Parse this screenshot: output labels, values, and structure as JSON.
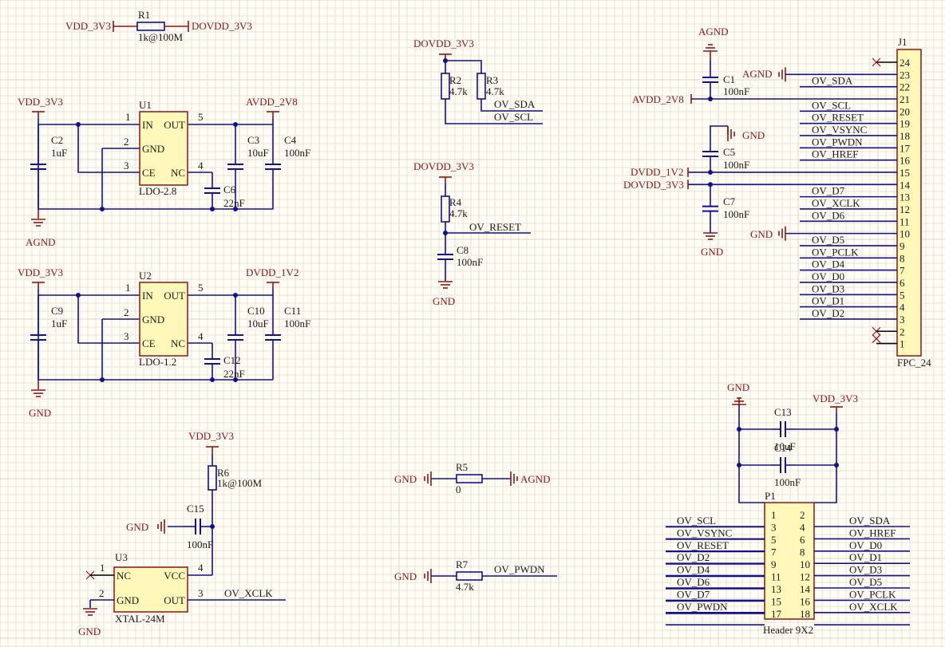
{
  "colors": {
    "wire": "#11118a",
    "power": "#8b1515",
    "pin": "#000000",
    "text": "#1a1a1a",
    "chip_fill": "#fff8b8",
    "chip_stroke": "#8b1515",
    "grid": "#e9e4d6",
    "grid_major": "#ddd6c4",
    "x_mark": "#a01010"
  },
  "r1": {
    "designator": "R1",
    "value": "1k@100M",
    "net_left": "VDD_3V3",
    "net_right": "DOVDD_3V3"
  },
  "u1": {
    "designator": "U1",
    "part": "LDO-2.8",
    "pin_in": "IN",
    "pin_out": "OUT",
    "pin_gnd": "GND",
    "pin_ce": "CE",
    "pin_nc": "NC",
    "num_1": "1",
    "num_2": "2",
    "num_3": "3",
    "num_4": "4",
    "num_5": "5",
    "net_in": "VDD_3V3",
    "net_out": "AVDD_2V8",
    "net_gnd": "AGND",
    "c_in": {
      "designator": "C2",
      "value": "1uF"
    },
    "c_out1": {
      "designator": "C3",
      "value": "10uF"
    },
    "c_out2": {
      "designator": "C4",
      "value": "100nF"
    },
    "c_nc": {
      "designator": "C6",
      "value": "22nF"
    }
  },
  "u2": {
    "designator": "U2",
    "part": "LDO-1.2",
    "pin_in": "IN",
    "pin_out": "OUT",
    "pin_gnd": "GND",
    "pin_ce": "CE",
    "pin_nc": "NC",
    "num_1": "1",
    "num_2": "2",
    "num_3": "3",
    "num_4": "4",
    "num_5": "5",
    "net_in": "VDD_3V3",
    "net_out": "DVDD_1V2",
    "net_gnd": "GND",
    "c_in": {
      "designator": "C9",
      "value": "1uF"
    },
    "c_out1": {
      "designator": "C10",
      "value": "10uF"
    },
    "c_out2": {
      "designator": "C11",
      "value": "100nF"
    },
    "c_nc": {
      "designator": "C12",
      "value": "22nF"
    }
  },
  "u3": {
    "designator": "U3",
    "part": "XTAL-24M",
    "pin_nc": "NC",
    "pin_vcc": "VCC",
    "pin_gnd": "GND",
    "pin_out": "OUT",
    "num_1": "1",
    "num_2": "2",
    "num_3": "3",
    "num_4": "4",
    "net_vdd": "VDD_3V3",
    "net_gnd": "GND",
    "net_gnd2": "GND",
    "net_out": "OV_XCLK",
    "r6": {
      "designator": "R6",
      "value": "1k@100M"
    },
    "c15": {
      "designator": "C15",
      "value": "100nF"
    }
  },
  "i2c": {
    "net_pwr": "DOVDD_3V3",
    "r2": {
      "designator": "R2",
      "value": "4.7k"
    },
    "r3": {
      "designator": "R3",
      "value": "4.7k"
    },
    "net_sda": "OV_SDA",
    "net_scl": "OV_SCL"
  },
  "reset": {
    "net_pwr": "DOVDD_3V3",
    "r4": {
      "designator": "R4",
      "value": "4.7k"
    },
    "net_reset": "OV_RESET",
    "c8": {
      "designator": "C8",
      "value": "100nF"
    },
    "net_gnd": "GND"
  },
  "r5": {
    "designator": "R5",
    "value": "0",
    "net_left": "GND",
    "net_right": "AGND"
  },
  "r7": {
    "designator": "R7",
    "value": "4.7k",
    "net_left": "GND",
    "net_right": "OV_PWDN"
  },
  "j1": {
    "designator": "J1",
    "part": "FPC_24",
    "pins": [
      "24",
      "23",
      "22",
      "21",
      "20",
      "19",
      "18",
      "17",
      "16",
      "15",
      "14",
      "13",
      "12",
      "11",
      "10",
      "9",
      "8",
      "7",
      "6",
      "5",
      "4",
      "3",
      "2",
      "1"
    ],
    "nets": {
      "agnd_top": "AGND",
      "agnd_23": "AGND",
      "sda": "OV_SDA",
      "avdd": "AVDD_2V8",
      "scl": "OV_SCL",
      "reset": "OV_RESET",
      "vsync": "OV_VSYNC",
      "pwdn": "OV_PWDN",
      "href": "OV_HREF",
      "gnd_top": "GND",
      "dvdd": "DVDD_1V2",
      "dovdd": "DOVDD_3V3",
      "d7": "OV_D7",
      "xclk": "OV_XCLK",
      "d6": "OV_D6",
      "gnd_10": "GND",
      "d5": "OV_D5",
      "pclk": "OV_PCLK",
      "d4": "OV_D4",
      "d0": "OV_D0",
      "d3": "OV_D3",
      "d1": "OV_D1",
      "d2": "OV_D2",
      "gnd_bottom": "GND"
    },
    "c1": {
      "designator": "C1",
      "value": "100nF"
    },
    "c5": {
      "designator": "C5",
      "value": "100nF"
    },
    "c7": {
      "designator": "C7",
      "value": "100nF"
    }
  },
  "p1": {
    "designator": "P1",
    "part": "Header 9X2",
    "net_gnd": "GND",
    "net_vdd": "VDD_3V3",
    "c13": {
      "designator": "C13",
      "value": "10uF"
    },
    "c14": {
      "designator": "C14",
      "value": "100nF"
    },
    "rows": [
      {
        "l": "1",
        "r": "2",
        "ln": "OV_SCL",
        "rn": "OV_SDA"
      },
      {
        "l": "3",
        "r": "4",
        "ln": "OV_VSYNC",
        "rn": "OV_HREF"
      },
      {
        "l": "5",
        "r": "6",
        "ln": "OV_RESET",
        "rn": "OV_D0"
      },
      {
        "l": "7",
        "r": "8",
        "ln": "OV_D2",
        "rn": "OV_D1"
      },
      {
        "l": "9",
        "r": "10",
        "ln": "OV_D4",
        "rn": "OV_D3"
      },
      {
        "l": "11",
        "r": "12",
        "ln": "OV_D6",
        "rn": "OV_D5"
      },
      {
        "l": "13",
        "r": "14",
        "ln": "OV_D7",
        "rn": "OV_PCLK"
      },
      {
        "l": "15",
        "r": "16",
        "ln": "OV_PWDN",
        "rn": "OV_XCLK"
      },
      {
        "l": "17",
        "r": "18",
        "ln": "",
        "rn": ""
      }
    ]
  }
}
